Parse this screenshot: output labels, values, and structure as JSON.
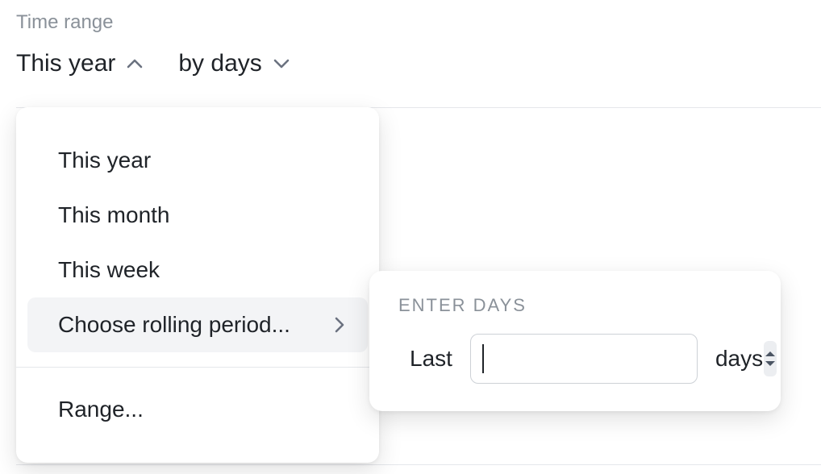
{
  "header": {
    "label": "Time range"
  },
  "selectors": {
    "range_button": "This year",
    "granularity_button": "by days"
  },
  "menu": {
    "items": [
      {
        "label": "This year"
      },
      {
        "label": "This month"
      },
      {
        "label": "This week"
      },
      {
        "label": "Choose rolling period..."
      }
    ],
    "range_label": "Range..."
  },
  "submenu": {
    "title": "ENTER DAYS",
    "prefix": "Last",
    "suffix": "days",
    "input_value": ""
  }
}
